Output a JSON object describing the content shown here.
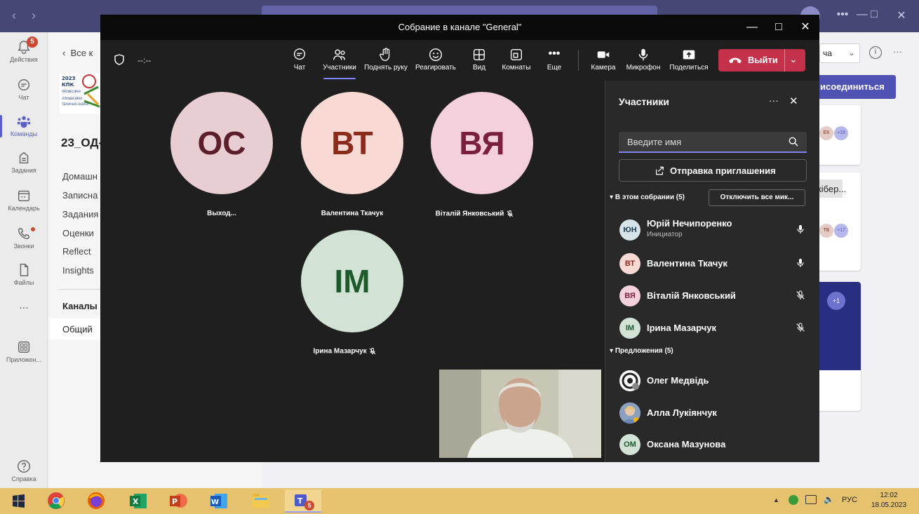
{
  "teams": {
    "rail": [
      {
        "label": "Действия",
        "badge": "5"
      },
      {
        "label": "Чат"
      },
      {
        "label": "Команды"
      },
      {
        "label": "Задания"
      },
      {
        "label": "Календарь"
      },
      {
        "label": "Звонки"
      },
      {
        "label": "Файлы"
      },
      {
        "label": "..."
      },
      {
        "label": "Приложен..."
      },
      {
        "label": "Справка"
      }
    ],
    "back_label": "Все к",
    "team_name": "23_ОД-",
    "channel_tabs": [
      "Домашн",
      "Записна",
      "Задания",
      "Оценки",
      "Reflect",
      "Insights"
    ],
    "channels_header": "Каналы",
    "channel_general": "Общий",
    "logo_text": "2023 КПК ПРОФЕСІЙНА (ПРОФЕСІЙНО ТЕХНІЧНА) ОСВІТА",
    "right_partial": {
      "dropdown": "ча",
      "join_button": "исоединиться",
      "card1_badge": "+19",
      "card2_text": "кібер...",
      "card2_badge": "+17",
      "card3_badge": "+1",
      "card1_chip": "ЕК",
      "card2_chip": "ТБ"
    }
  },
  "meeting": {
    "title": "Собрание в канале \"General\"",
    "timer": "--:--",
    "toolbar": {
      "chat": "Чат",
      "participants": "Участники",
      "raise_hand": "Поднять руку",
      "react": "Реагировать",
      "view": "Вид",
      "rooms": "Комнаты",
      "more": "Еще",
      "camera": "Камера",
      "mic": "Микрофон",
      "share": "Поделиться",
      "leave": "Выйти"
    },
    "tiles": [
      {
        "initials": "ОС",
        "name": "Выход...",
        "bg": "#e8cdd2",
        "fg": "#5c1f2a"
      },
      {
        "initials": "ВТ",
        "name": "Валентина Ткачук",
        "bg": "#f9d9d4",
        "fg": "#8a2b1c"
      },
      {
        "initials": "ВЯ",
        "name": "Віталій Янковський",
        "bg": "#f3d0dc",
        "fg": "#7a1f3d",
        "muted": true
      },
      {
        "initials": "ІМ",
        "name": "Ірина Мазарчук",
        "bg": "#d2e3d6",
        "fg": "#1d5a2c",
        "muted": true
      }
    ]
  },
  "roster": {
    "title": "Участники",
    "search_placeholder": "Введите имя",
    "invite": "Отправка приглашения",
    "in_meeting": "В этом собрании (5)",
    "mute_all": "Отключить все мик...",
    "people": [
      {
        "initials": "ЮН",
        "name": "Юрій Нечипоренко",
        "sub": "Инициатор",
        "bg": "#d6e4ea",
        "fg": "#1f3f55",
        "mic": "on"
      },
      {
        "initials": "ВТ",
        "name": "Валентина Ткачук",
        "sub": "",
        "bg": "#f9d9d4",
        "fg": "#8a2b1c",
        "mic": "on"
      },
      {
        "initials": "ВЯ",
        "name": "Віталій Янковський",
        "sub": "",
        "bg": "#f3d0dc",
        "fg": "#7a1f3d",
        "mic": "off"
      },
      {
        "initials": "ІМ",
        "name": "Ірина Мазарчук",
        "sub": "",
        "bg": "#d2e3d6",
        "fg": "#1d5a2c",
        "mic": "off"
      }
    ],
    "suggestions_header": "Предложения (5)",
    "suggestions": [
      {
        "name": "Олег Медвідь"
      },
      {
        "name": "Алла Лукіянчук"
      },
      {
        "initials": "ОМ",
        "name": "Оксана Мазунова"
      }
    ]
  },
  "taskbar": {
    "lang": "РУС",
    "time": "12:02",
    "date": "18.05.2023",
    "teams_badge": "5"
  }
}
